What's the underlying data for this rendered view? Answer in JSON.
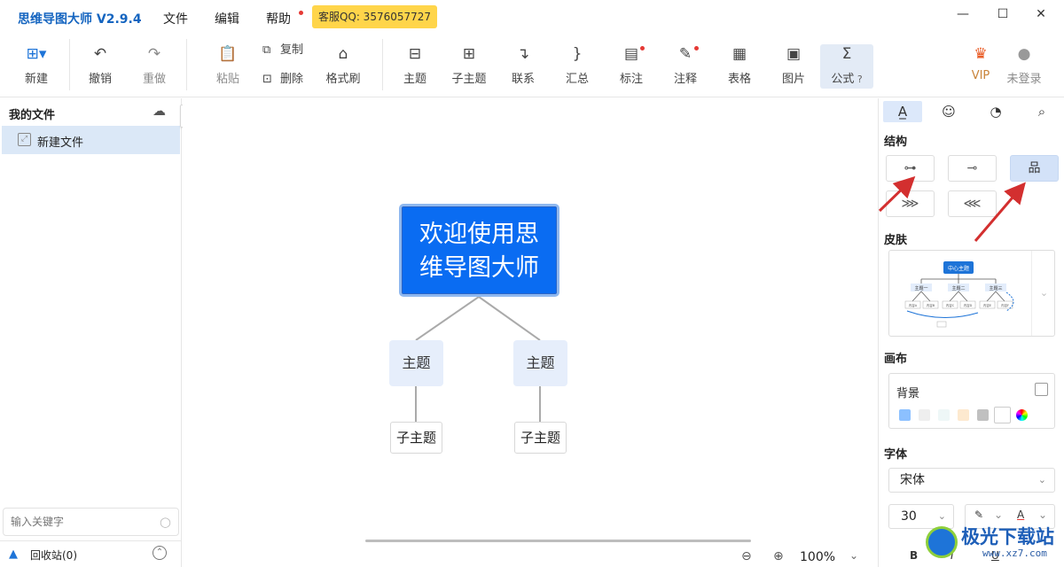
{
  "app": {
    "title": "思维导图大师 V2.9.4",
    "menu": [
      "文件",
      "编辑",
      "帮助"
    ],
    "service_badge": "客服QQ: 3576057727",
    "window_controls": [
      "minimize-icon",
      "maximize-icon",
      "close-icon"
    ]
  },
  "toolbar": {
    "new": "新建",
    "undo": "撤销",
    "redo": "重做",
    "paste": "粘贴",
    "copy": "复制",
    "delete": "删除",
    "format_painter": "格式刷",
    "topic": "主题",
    "subtopic": "子主题",
    "relation": "联系",
    "summary": "汇总",
    "label": "标注",
    "note": "注释",
    "table": "表格",
    "image": "图片",
    "formula": "公式",
    "vip": "VIP",
    "login": "未登录"
  },
  "left_panel": {
    "title": "我的文件",
    "files": [
      "新建文件"
    ],
    "search_placeholder": "输入关键字",
    "recycle_bin": "回收站(0)"
  },
  "mindmap": {
    "root": "欢迎使用思维导图大师",
    "root_line1": "欢迎使用思",
    "root_line2": "维导图大师",
    "topics": [
      {
        "label": "主题",
        "subtopic": "子主题"
      },
      {
        "label": "主题",
        "subtopic": "子主题"
      }
    ]
  },
  "status": {
    "zoom": "100%"
  },
  "right_panel": {
    "tabs": [
      "style-icon",
      "emoji-icon",
      "theme-icon",
      "search-icon"
    ],
    "structure_title": "结构",
    "skin_title": "皮肤",
    "skin_preview": {
      "center": "中心主题",
      "branches": [
        "主题一",
        "主题二",
        "主题三"
      ],
      "leaves": [
        "内容A",
        "内容B",
        "内容C",
        "内容D",
        "内容E",
        "内容F"
      ]
    },
    "canvas_title": "画布",
    "background_label": "背景",
    "font_title": "字体",
    "font_family": "宋体",
    "font_size": "30",
    "format_buttons": [
      "B",
      "I",
      "U"
    ],
    "swatches": [
      "#8cc0ff",
      "#eeeeee",
      "#eef7f7",
      "#fde9cf",
      "#c0c0c0",
      "#ffffff",
      "rainbow"
    ]
  },
  "colors": {
    "accent": "#1565c0",
    "root_fill": "#0a6cf2",
    "topic_fill": "#e6eefb",
    "selection": "#dbe8f7",
    "badge": "#ffd54a",
    "annotation_arrow": "#d32f2f"
  },
  "watermark": {
    "text": "极光下载站",
    "url": "www.xz7.com"
  }
}
